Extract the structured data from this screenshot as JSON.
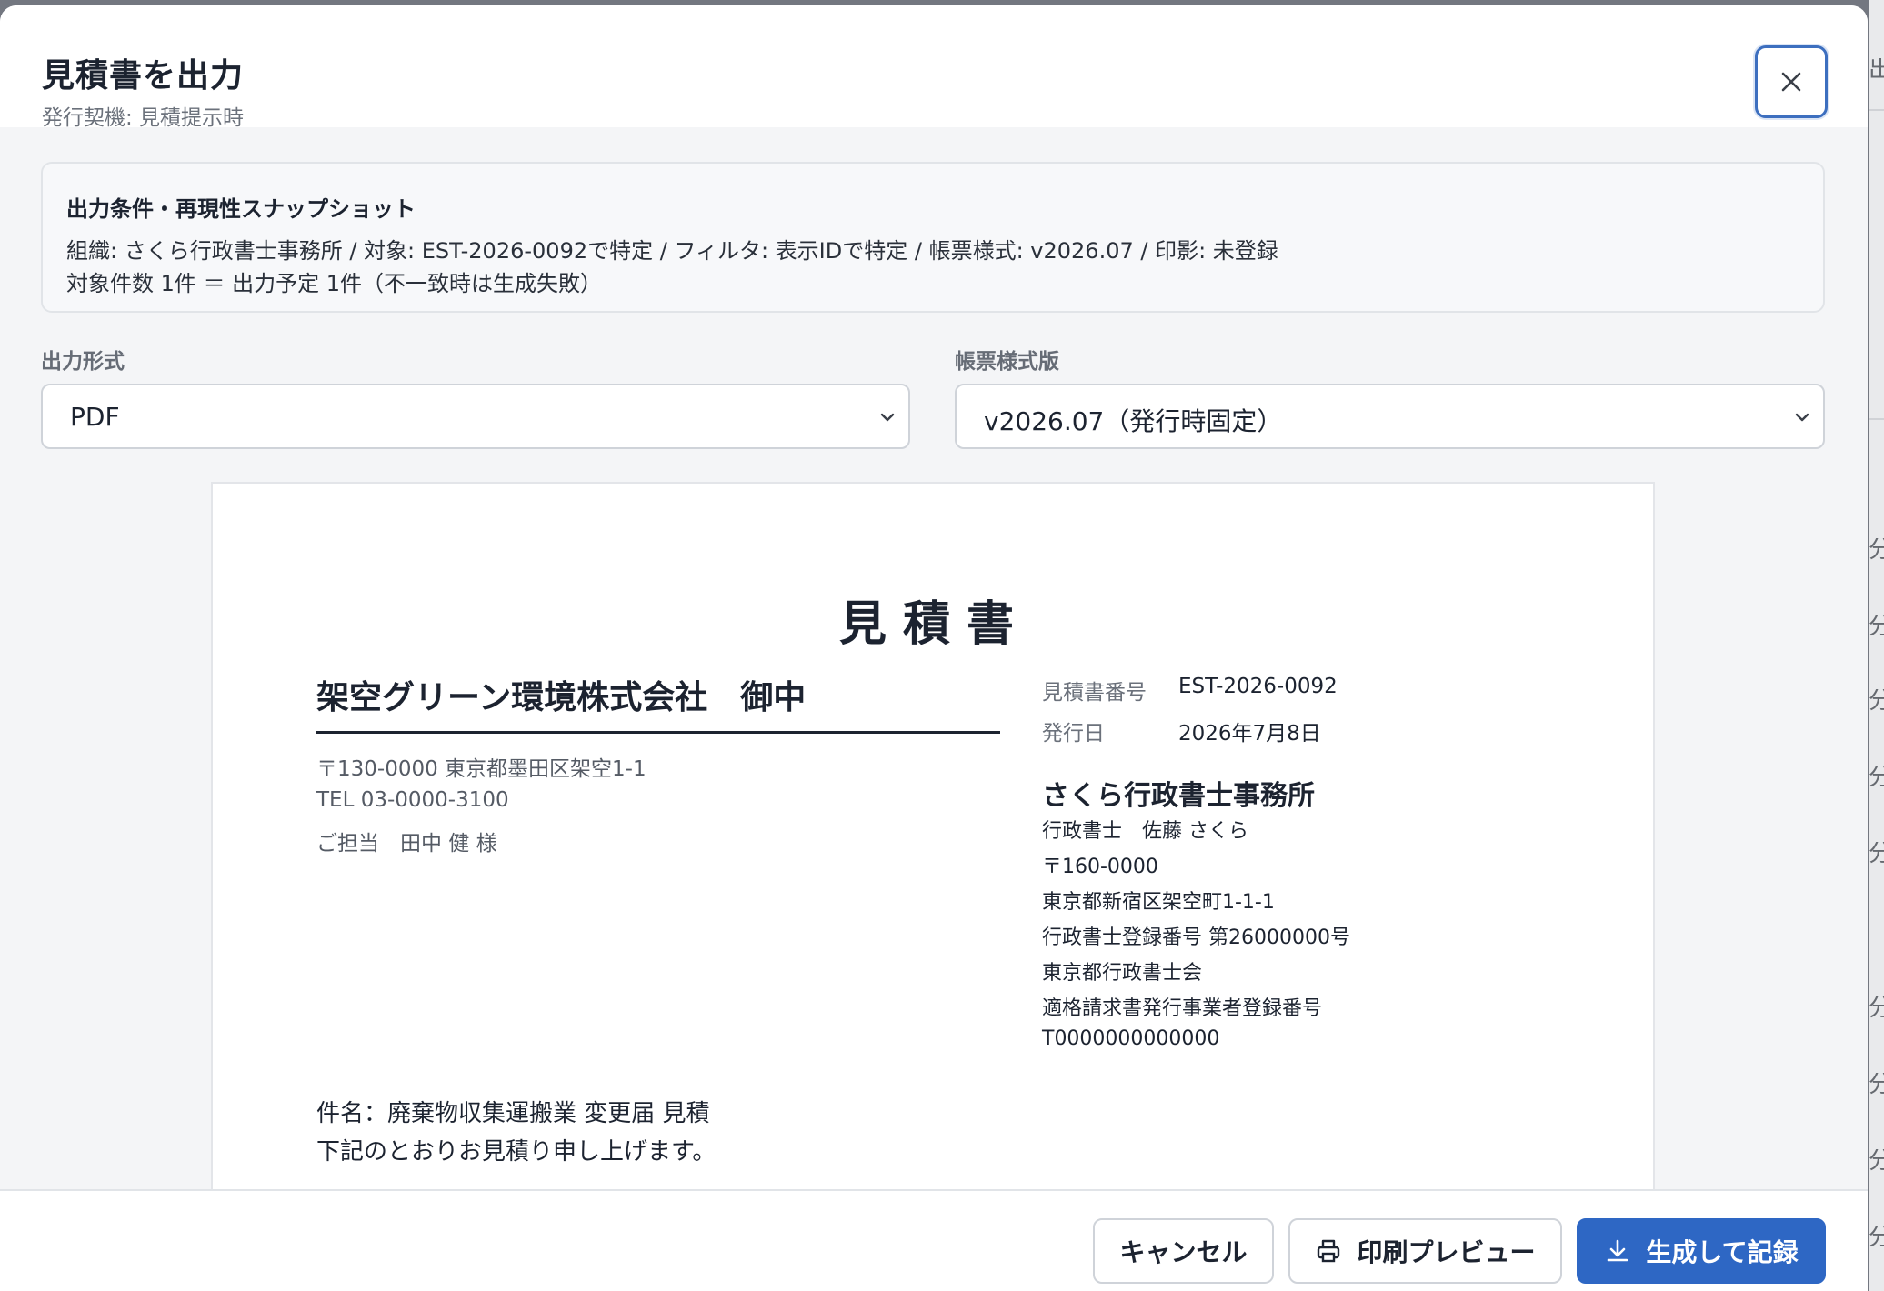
{
  "modal": {
    "title": "見積書を出力",
    "subtitle": "発行契機: 見積提示時"
  },
  "conditions": {
    "title": "出力条件・再現性スナップショット",
    "line1": "組織: さくら行政書士事務所 / 対象: EST-2026-0092で特定 / フィルタ: 表示IDで特定 / 帳票様式: v2026.07 / 印影: 未登録",
    "line2": "対象件数 1件 ＝ 出力予定 1件（不一致時は生成失敗）"
  },
  "format_field": {
    "label": "出力形式",
    "value": "PDF"
  },
  "template_field": {
    "label": "帳票様式版",
    "value": "v2026.07（発行時固定）"
  },
  "document": {
    "title": "見積書",
    "client": {
      "name": "架空グリーン環境株式会社　御中",
      "address": "〒130-0000 東京都墨田区架空1-1",
      "tel": "TEL 03-0000-3100",
      "contact": "ご担当　田中 健 様"
    },
    "meta": [
      {
        "label": "見積書番号",
        "value": "EST-2026-0092"
      },
      {
        "label": "発行日",
        "value": "2026年7月8日"
      }
    ],
    "issuer": {
      "name": "さくら行政書士事務所",
      "lines": [
        "行政書士　佐藤 さくら",
        "〒160-0000",
        "東京都新宿区架空町1-1-1",
        "行政書士登録番号 第26000000号",
        "東京都行政書士会",
        "適格請求書発行事業者登録番号",
        "T0000000000000"
      ]
    },
    "subject": "件名：廃棄物収集運搬業 変更届 見積",
    "intro": "下記のとおりお見積り申し上げます。"
  },
  "footer": {
    "cancel_label": "キャンセル",
    "preview_label": "印刷プレビュー",
    "generate_label": "生成して記録"
  },
  "backdrop": {
    "top_label": "出",
    "row_labels": [
      "分",
      "分",
      "分",
      "分",
      "分",
      "分",
      "分",
      "分",
      "分",
      "分"
    ]
  },
  "colors": {
    "primary": "#2e67c4",
    "focus_ring": "#3d6fbf",
    "text": "#1c2330"
  },
  "icons": {
    "close": "close-icon",
    "chevron": "chevron-down-icon",
    "print": "printer-icon",
    "download": "download-icon"
  }
}
